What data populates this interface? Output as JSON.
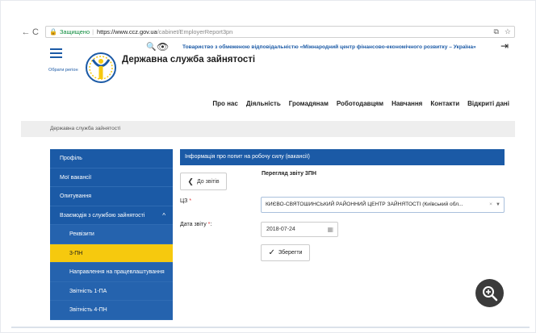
{
  "browser": {
    "back": "←",
    "reload": "C",
    "secure_label": "Защищено",
    "url_host": "https://www.ccz.gov.ua",
    "url_path": "/cabinet/EmployerReport3pn"
  },
  "header": {
    "choose_region": "Обрати регіон",
    "site_title": "Державна служба зайнятості",
    "org_link": "Товариство з обмеженою відповідальністю «Міжнародний центр фінансово-економічного розвитку – Україна»"
  },
  "main_nav": [
    "Про нас",
    "Діяльність",
    "Громадянам",
    "Роботодавцям",
    "Навчання",
    "Контакти",
    "Відкриті дані"
  ],
  "breadcrumb": "Державна служба зайнятості",
  "sidebar": {
    "items": [
      {
        "label": "Профіль"
      },
      {
        "label": "Мої вакансії"
      },
      {
        "label": "Опитування"
      },
      {
        "label": "Взаємодія з службою зайнятості"
      },
      {
        "label": "Реквізити"
      },
      {
        "label": "3-ПН"
      },
      {
        "label": "Направлення на працевлаштування"
      },
      {
        "label": "Звітність 1-ПА"
      },
      {
        "label": "Звітність 4-ПН"
      }
    ],
    "expand_chevron": "^"
  },
  "content": {
    "panel_title": "Інформація про попит на робочу силу (вакансії)",
    "back_label": "До звітів",
    "view_title": "Перегляд звіту 3ПН",
    "cz_label": "ЦЗ",
    "cz_value": "КИЄВО-СВЯТОШИНСЬКИЙ РАЙОННИЙ ЦЕНТР ЗАЙНЯТОСТІ (Київський обл...",
    "date_label": "Дата звіту",
    "date_value": "2018-07-24",
    "save_label": "Зберегти",
    "required_mark": "*"
  },
  "colors": {
    "brand_blue": "#1b5aa6",
    "active_yellow": "#f6c90e"
  }
}
